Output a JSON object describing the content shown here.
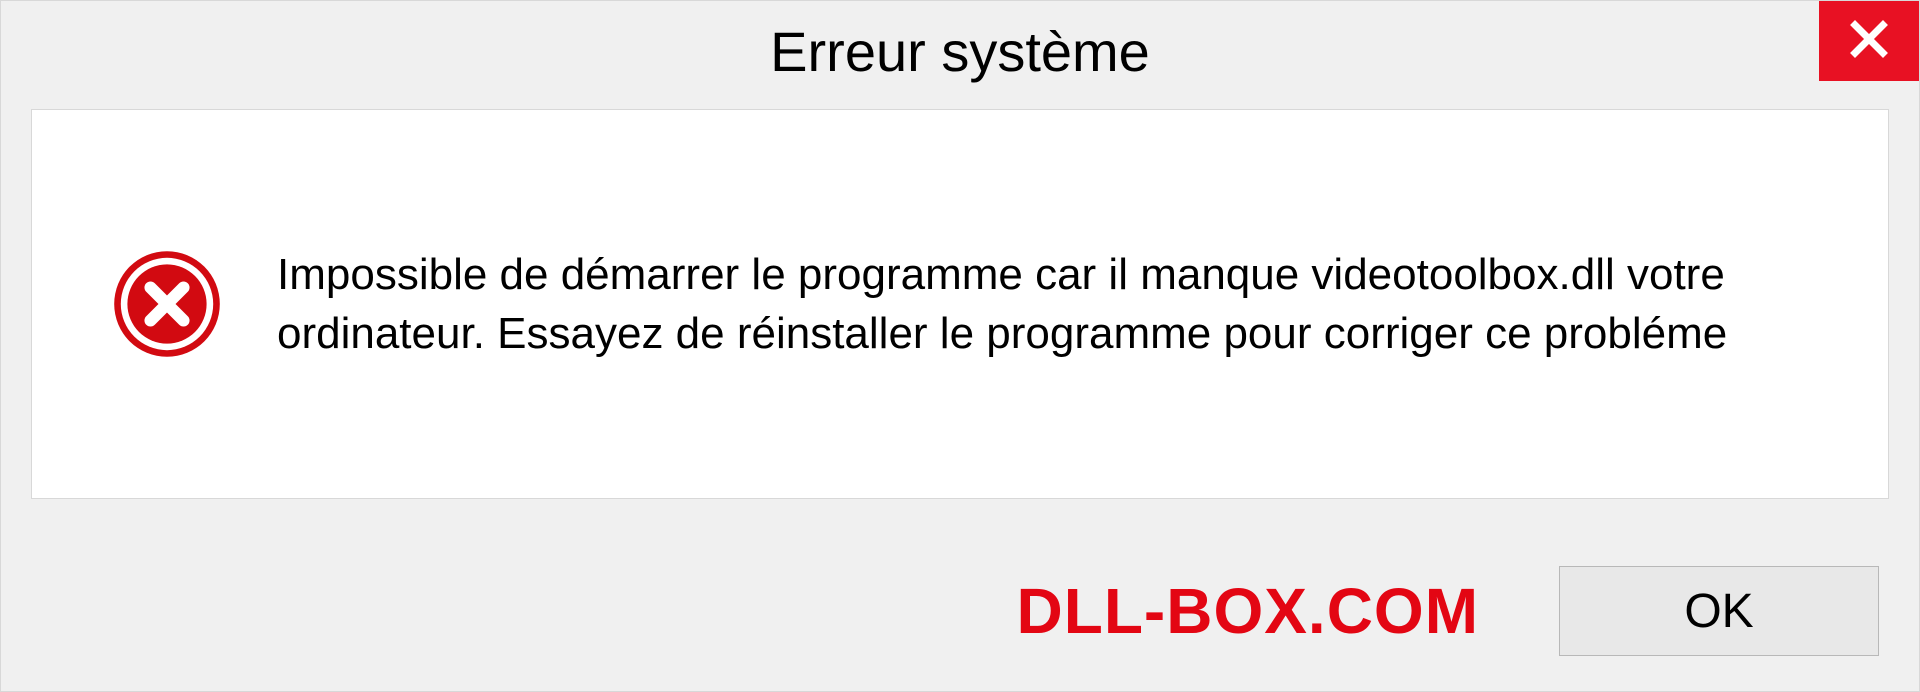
{
  "dialog": {
    "title": "Erreur système",
    "message": "Impossible de démarrer le programme car il manque videotoolbox.dll votre ordinateur. Essayez de réinstaller le programme pour corriger ce probléme",
    "ok_label": "OK",
    "brand": "DLL-BOX.COM"
  },
  "colors": {
    "close_bg": "#e81123",
    "brand_red": "#e30613",
    "error_icon": "#d20a11"
  }
}
